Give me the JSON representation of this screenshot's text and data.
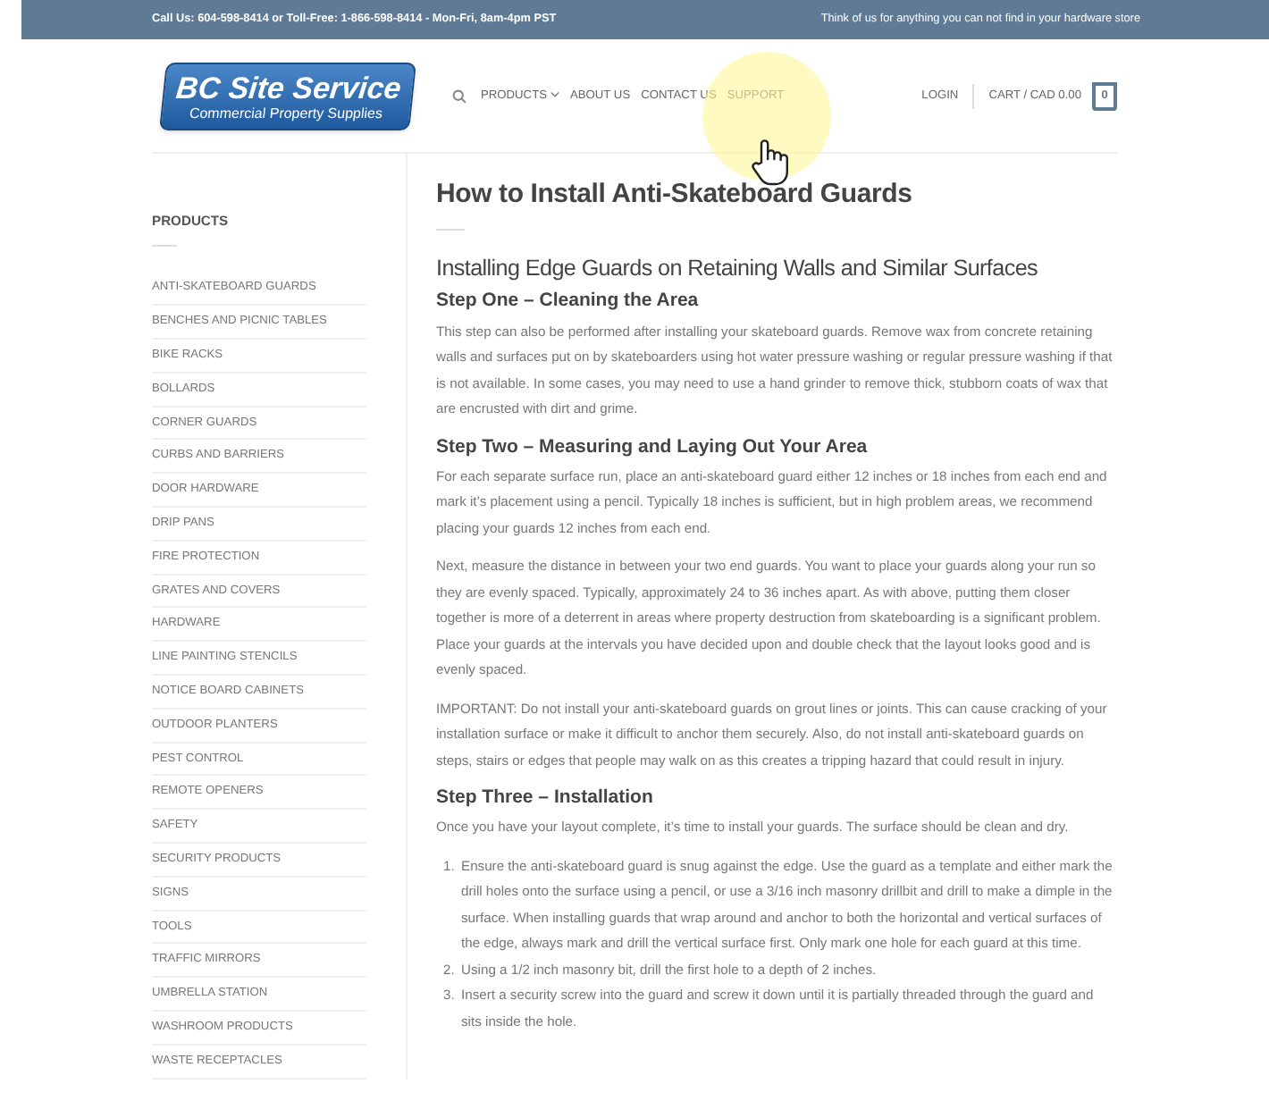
{
  "top_bar": {
    "contact": "Call Us: 604-598-8414 or Toll-Free: 1-866-598-8414 - Mon-Fri, 8am-4pm PST",
    "tagline": "Think of us for anything you can not find in your hardware store"
  },
  "header": {
    "logo": {
      "title": "BC Site Service",
      "subtitle": "Commercial Property Supplies"
    },
    "nav": [
      {
        "label": "PRODUCTS",
        "dropdown": true
      },
      {
        "label": "ABOUT US",
        "dropdown": false
      },
      {
        "label": "CONTACT US",
        "dropdown": false
      },
      {
        "label": "SUPPORT",
        "dropdown": false
      }
    ],
    "login": "LOGIN",
    "cart": "CART / CAD 0.00",
    "cart_count": "0"
  },
  "sidebar": {
    "title": "PRODUCTS",
    "items": [
      "ANTI-SKATEBOARD GUARDS",
      "BENCHES AND PICNIC TABLES",
      "BIKE RACKS",
      "BOLLARDS",
      "CORNER GUARDS",
      "CURBS AND BARRIERS",
      "DOOR HARDWARE",
      "DRIP PANS",
      "FIRE PROTECTION",
      "GRATES AND COVERS",
      "HARDWARE",
      "LINE PAINTING STENCILS",
      "NOTICE BOARD CABINETS",
      "OUTDOOR PLANTERS",
      "PEST CONTROL",
      "REMOTE OPENERS",
      "SAFETY",
      "SECURITY PRODUCTS",
      "SIGNS",
      "TOOLS",
      "TRAFFIC MIRRORS",
      "UMBRELLA STATION",
      "WASHROOM PRODUCTS",
      "WASTE RECEPTACLES"
    ]
  },
  "article": {
    "title": "How to Install Anti-Skateboard Guards",
    "blocks": [
      {
        "kind": "h2",
        "text": "Installing Edge Guards on Retaining Walls and Similar Surfaces"
      },
      {
        "kind": "h3",
        "text": "Step One – Cleaning the Area"
      },
      {
        "kind": "p",
        "text": "This step can also be performed after installing your skateboard guards. Remove wax from concrete retaining walls and surfaces put on by skateboarders using hot water pressure washing or regular pressure washing if that is not available. In some cases, you may need to use a hand grinder to remove thick, stubborn coats of wax that are encrusted with dirt and grime."
      },
      {
        "kind": "h3",
        "text": "Step Two – Measuring and Laying Out Your Area"
      },
      {
        "kind": "p",
        "text": "For each separate surface run, place an anti-skateboard guard either 12 inches or 18 inches from each end and mark it’s placement using a pencil. Typically 18 inches is sufficient, but in high problem areas, we recommend placing your guards 12 inches from each end."
      },
      {
        "kind": "p",
        "text": "Next, measure the distance in between your two end guards. You want to place your guards along your run so they are evenly spaced. Typically, approximately 24 to 36 inches apart. As with above, putting them closer together is more of a deterrent in areas where property destruction from skateboarding is a significant problem. Place your guards at the intervals you have decided upon and double check that the layout looks good and is evenly spaced."
      },
      {
        "kind": "p",
        "text": "IMPORTANT: Do not install your anti-skateboard guards on grout lines or joints. This can cause cracking of your installation surface or make it difficult to anchor them securely. Also, do not install anti-skateboard guards on steps, stairs or edges that people may walk on as this creates a tripping hazard that could result in injury."
      },
      {
        "kind": "h3",
        "text": "Step Three – Installation"
      },
      {
        "kind": "p",
        "text": "Once you have your layout complete, it’s time to install your guards. The surface should be clean and dry."
      },
      {
        "kind": "ol",
        "items": [
          {
            "marker": "1.",
            "text": "Ensure the anti-skateboard guard is snug against the edge. Use the guard as a template and either mark the drill holes onto the surface using a pencil, or use a 3/16 inch masonry drillbit and drill to make a dimple in the surface. When installing guards that wrap around and anchor to both the horizontal and vertical surfaces of the edge, always mark and drill the vertical surface first. Only mark one hole for each guard at this time."
          },
          {
            "marker": "2.",
            "text": "Using a 1/2 inch masonry bit, drill the first hole to a depth of 2 inches."
          },
          {
            "marker": "3.",
            "text": "Insert a security screw into the guard and screw it down until it is partially threaded through the guard and sits inside the hole."
          }
        ]
      }
    ]
  }
}
